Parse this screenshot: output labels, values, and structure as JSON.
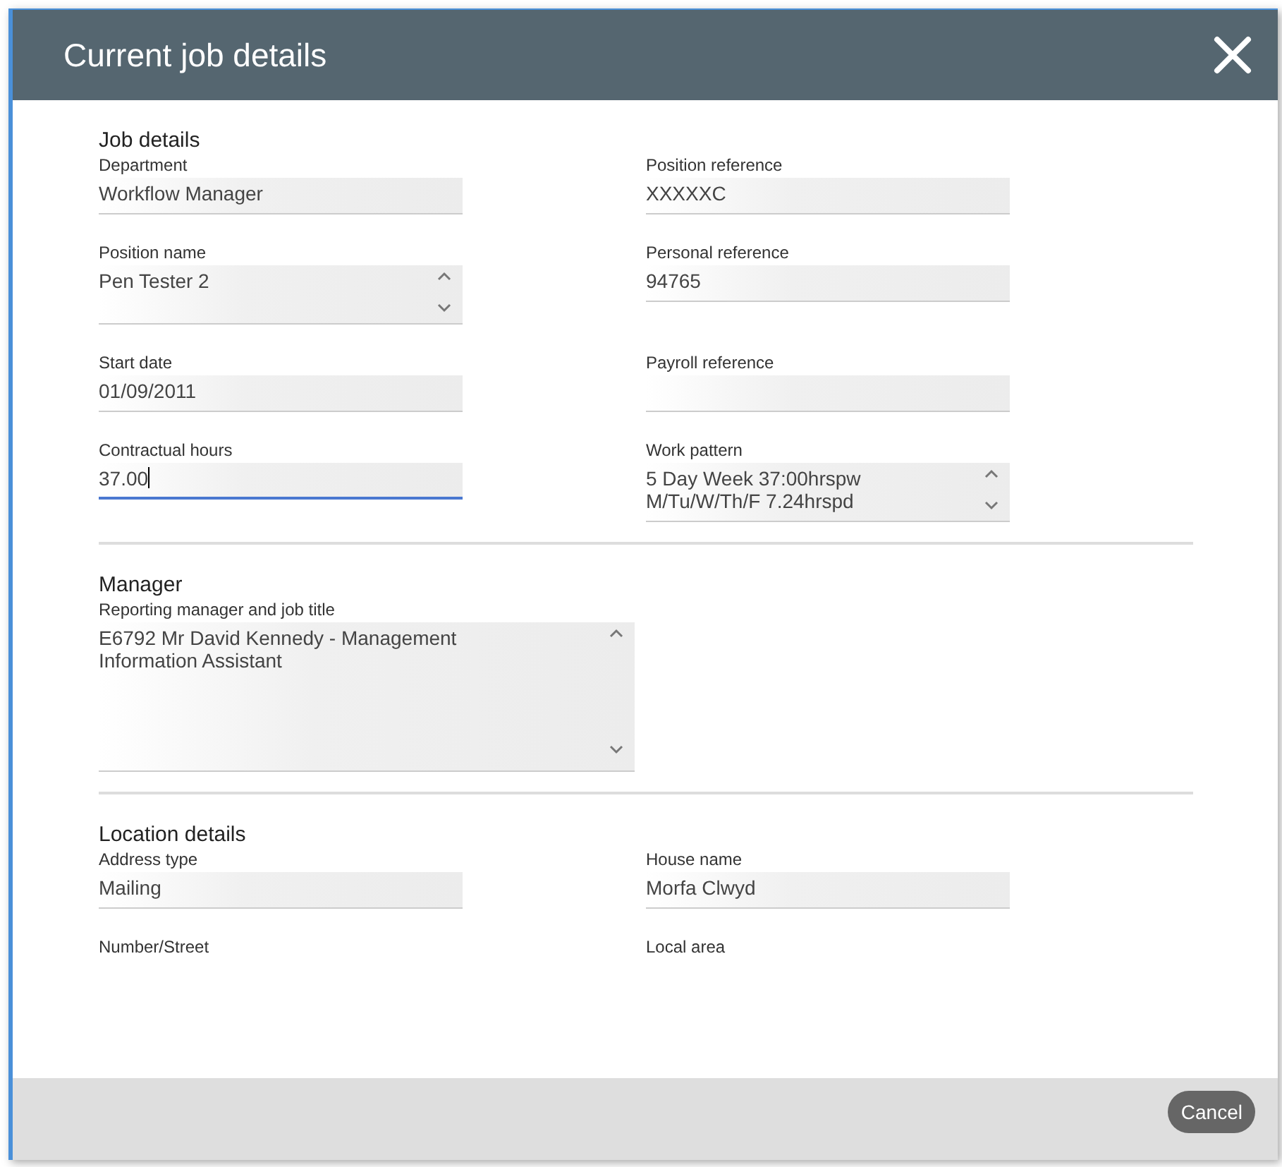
{
  "window": {
    "title": "Current job details"
  },
  "sections": [
    {
      "title": "Job details",
      "fields": [
        {
          "label": "Department",
          "value": "Workflow Manager",
          "kind": "single",
          "focused": false
        },
        {
          "label": "Position reference",
          "value": "XXXXXC",
          "kind": "single",
          "focused": false
        },
        {
          "label": "Position name",
          "value": "Pen Tester 2",
          "kind": "multiline",
          "focused": false
        },
        {
          "label": "Personal reference",
          "value": "94765",
          "kind": "single",
          "focused": false
        },
        {
          "label": "Start date",
          "value": "01/09/2011",
          "kind": "single",
          "focused": false
        },
        {
          "label": "Payroll reference",
          "kind": "single",
          "focused": false
        },
        {
          "label": "Contractual hours",
          "value": "37.00",
          "kind": "single",
          "focused": true
        },
        {
          "label": "Work pattern",
          "value": "5 Day Week 37:00hrspw\nM/Tu/W/Th/F 7.24hrspd",
          "kind": "multiline",
          "focused": false
        }
      ]
    },
    {
      "title": "Manager",
      "fields": [
        {
          "label": "Reporting manager and job title",
          "value": "E6792 Mr David  Kennedy - Management\nInformation Assistant",
          "kind": "textarea",
          "focused": false
        }
      ]
    },
    {
      "title": "Location details",
      "fields": [
        {
          "label": "Address type",
          "value": "Mailing",
          "kind": "single",
          "focused": false
        },
        {
          "label": "House name",
          "value": "Morfa Clwyd",
          "kind": "single",
          "focused": false
        },
        {
          "label": "Number/Street",
          "kind": "label"
        },
        {
          "label": "Local area",
          "kind": "label"
        }
      ]
    }
  ],
  "buttons": [
    {
      "label": "Cancel"
    }
  ]
}
